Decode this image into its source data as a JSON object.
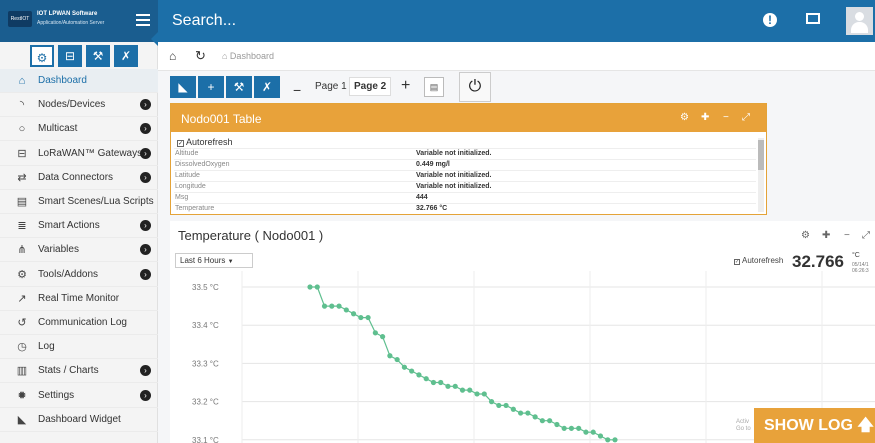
{
  "app": {
    "logo_mark": "RestIOT",
    "logo_title": "IOT LPWAN Software",
    "logo_subtitle": "Application/Automation Server"
  },
  "header": {
    "search_label": "Search...",
    "icons": [
      "hamburger-icon",
      "alert-icon",
      "mail-icon",
      "user-avatar"
    ]
  },
  "sidebar": {
    "top_buttons": [
      {
        "icon": "gear-icon",
        "glyph": "⚙"
      },
      {
        "icon": "lock-icon",
        "glyph": "⊟"
      },
      {
        "icon": "wand-icon",
        "glyph": "⚒"
      },
      {
        "icon": "plug-icon",
        "glyph": "✗"
      }
    ],
    "items": [
      {
        "label": "Dashboard",
        "icon": "home-icon",
        "glyph": "⌂",
        "chevron": false,
        "active": true
      },
      {
        "label": "Nodes/Devices",
        "icon": "rss-icon",
        "glyph": "◝",
        "chevron": true
      },
      {
        "label": "Multicast",
        "icon": "circle-icon",
        "glyph": "○",
        "chevron": true
      },
      {
        "label": "LoRaWAN™ Gateways",
        "icon": "gateway-icon",
        "glyph": "⊟",
        "chevron": true
      },
      {
        "label": "Data Connectors",
        "icon": "exchange-icon",
        "glyph": "⇄",
        "chevron": true
      },
      {
        "label": "Smart Scenes/Lua Scripts",
        "icon": "film-icon",
        "glyph": "▤",
        "chevron": false
      },
      {
        "label": "Smart Actions",
        "icon": "list-icon",
        "glyph": "≣",
        "chevron": true
      },
      {
        "label": "Variables",
        "icon": "sitemap-icon",
        "glyph": "⋔",
        "chevron": true
      },
      {
        "label": "Tools/Addons",
        "icon": "tools-icon",
        "glyph": "⚙",
        "chevron": true
      },
      {
        "label": "Real Time Monitor",
        "icon": "linechart-icon",
        "glyph": "↗",
        "chevron": false
      },
      {
        "label": "Communication Log",
        "icon": "history-icon",
        "glyph": "↺",
        "chevron": false
      },
      {
        "label": "Log",
        "icon": "clock-icon",
        "glyph": "◷",
        "chevron": false
      },
      {
        "label": "Stats / Charts",
        "icon": "barchart-icon",
        "glyph": "▥",
        "chevron": true
      },
      {
        "label": "Settings",
        "icon": "gear-icon",
        "glyph": "✹",
        "chevron": true
      },
      {
        "label": "Dashboard Widget",
        "icon": "areachart-icon",
        "glyph": "◣",
        "chevron": false
      }
    ]
  },
  "breadcrumb": {
    "home_glyph": "⌂",
    "reload_glyph": "↻",
    "label": "⌂ Dashboard"
  },
  "toolbar": {
    "buttons": [
      {
        "icon": "chart-icon",
        "glyph": "◣"
      },
      {
        "icon": "plus-icon",
        "glyph": "+"
      },
      {
        "icon": "wand-icon",
        "glyph": "⚒"
      },
      {
        "icon": "plug-icon",
        "glyph": "✗"
      }
    ],
    "dash": "−",
    "pages": [
      "Page 1",
      "Page 2"
    ],
    "selected_page": "Page 2",
    "plus": "+",
    "save_glyph": "▤",
    "power_glyph": "⏻"
  },
  "table_widget": {
    "title": "Nodo001 Table",
    "autorefresh_label": "Autorefresh",
    "autorefresh_checked": true,
    "rows": [
      {
        "key": "Altitude",
        "value": "Variable not initialized."
      },
      {
        "key": "DissolvedOxygen",
        "value": "0.449 mg/l"
      },
      {
        "key": "Latitude",
        "value": "Variable not initialized."
      },
      {
        "key": "Longitude",
        "value": "Variable not initialized."
      },
      {
        "key": "Msg",
        "value": "444"
      },
      {
        "key": "Temperature",
        "value": "32.766 °C"
      }
    ]
  },
  "chart_widget": {
    "title": "Temperature ( Nodo001 )",
    "range_select": "Last 6 Hours",
    "autorefresh_label": "Autorefresh",
    "autorefresh_checked": true,
    "current_value": "32.766",
    "current_unit": "°C",
    "timestamp_line1": "05/14/1",
    "timestamp_line2": "06:26:3"
  },
  "chart_data": {
    "type": "line",
    "title": "Temperature ( Nodo001 )",
    "xlabel": "",
    "ylabel": "",
    "ylim": [
      33.08,
      33.52
    ],
    "yticks": [
      33.5,
      33.4,
      33.3,
      33.2,
      33.1
    ],
    "ytick_labels": [
      "33.5 °C",
      "33.4 °C",
      "33.3 °C",
      "33.2 °C",
      "33.1 °C"
    ],
    "grid": true,
    "color": "#5fbf8f",
    "x": [
      0,
      1,
      2,
      3,
      4,
      5,
      6,
      7,
      8,
      9,
      10,
      11,
      12,
      13,
      14,
      15,
      16,
      17,
      18,
      19,
      20,
      21,
      22,
      23,
      24,
      25,
      26,
      27,
      28,
      29,
      30,
      31,
      32,
      33,
      34,
      35,
      36,
      37,
      38,
      39,
      40,
      41,
      42
    ],
    "values": [
      33.5,
      33.5,
      33.45,
      33.45,
      33.45,
      33.44,
      33.43,
      33.42,
      33.42,
      33.38,
      33.37,
      33.32,
      33.31,
      33.29,
      33.28,
      33.27,
      33.26,
      33.25,
      33.25,
      33.24,
      33.24,
      33.23,
      33.23,
      33.22,
      33.22,
      33.2,
      33.19,
      33.19,
      33.18,
      33.17,
      33.17,
      33.16,
      33.15,
      33.15,
      33.14,
      33.13,
      33.13,
      33.13,
      33.12,
      33.12,
      33.11,
      33.1,
      33.1
    ]
  },
  "footer": {
    "show_log_label": "SHOW LOG",
    "show_log_glyph": "🡅",
    "activate_line1": "Activ",
    "activate_line2": "Go to"
  }
}
